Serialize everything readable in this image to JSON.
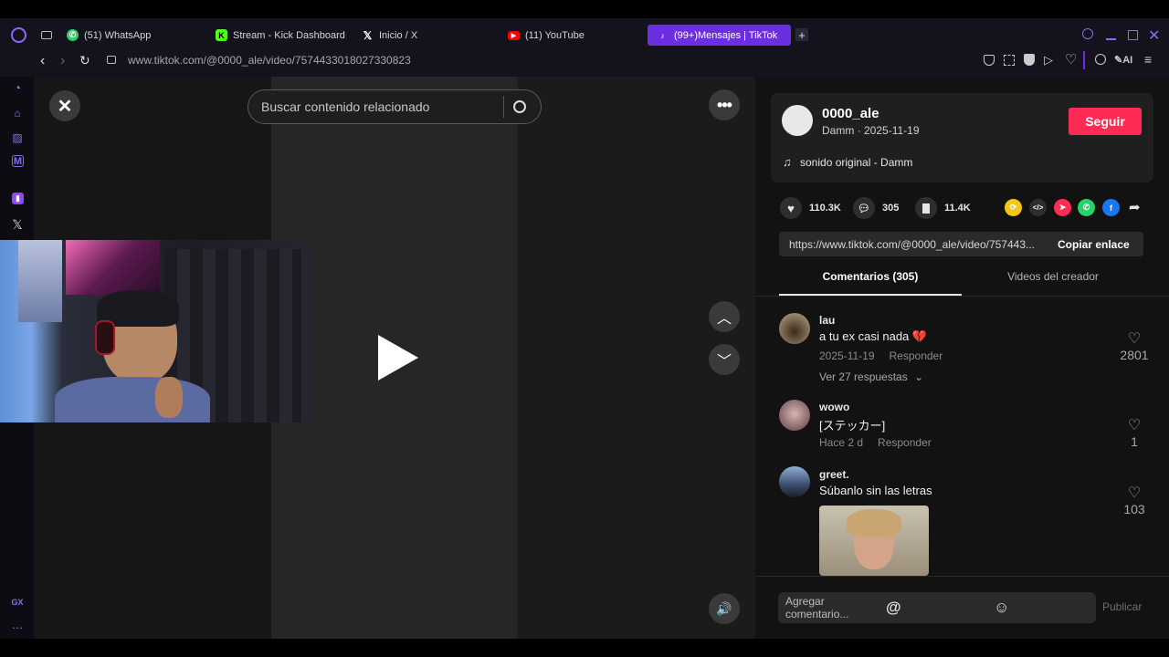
{
  "browser": {
    "tabs": [
      {
        "label": "(51) WhatsApp",
        "icon": "whatsapp-icon",
        "color": "#25d366"
      },
      {
        "label": "Stream - Kick Dashboard",
        "icon": "kick-icon",
        "color": "#53fc18"
      },
      {
        "label": "Inicio / X",
        "icon": "x-icon",
        "color": "#ffffff"
      },
      {
        "label": "(11) YouTube",
        "icon": "youtube-icon",
        "color": "#ff0000"
      },
      {
        "label": "(99+)Mensajes | TikTok",
        "icon": "tiktok-icon",
        "color": "#ffffff"
      }
    ],
    "url": "www.tiktok.com/@0000_ale/video/7574433018027330823",
    "ai_label": "AI",
    "sidebar_gx": "GX",
    "accent": "#6b2ee0"
  },
  "player": {
    "search_placeholder": "Buscar contenido relacionado"
  },
  "author": {
    "username": "0000_ale",
    "subtitle": "Damm · 2025-11-19",
    "follow_label": "Seguir",
    "sound": "sonido original - Damm"
  },
  "stats": {
    "likes": "110.3K",
    "comments": "305",
    "saves": "11.4K"
  },
  "link": {
    "url": "https://www.tiktok.com/@0000_ale/video/757443...",
    "copy_label": "Copiar enlace"
  },
  "panel_tabs": {
    "comments": "Comentarios (305)",
    "creator_videos": "Videos del creador"
  },
  "comments": [
    {
      "user": "lau",
      "text": "a tu ex casi nada 💔",
      "date": "2025-11-19",
      "reply": "Responder",
      "likes": "2801",
      "replies": "Ver 27 respuestas"
    },
    {
      "user": "wowo",
      "text": "[ステッカー]",
      "date": "Hace 2 d",
      "reply": "Responder",
      "likes": "1"
    },
    {
      "user": "greet.",
      "text": "Súbanlo sin las letras",
      "likes": "103"
    }
  ],
  "composer": {
    "placeholder": "Agregar comentario...",
    "post_label": "Publicar"
  }
}
